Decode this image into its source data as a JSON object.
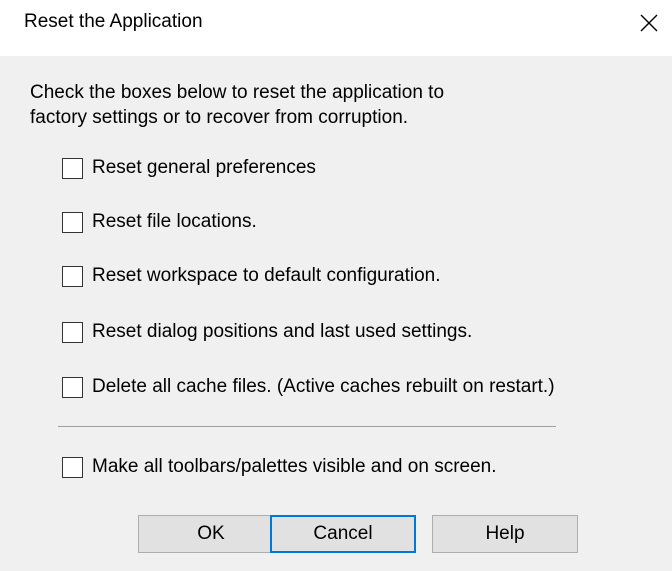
{
  "window": {
    "title": "Reset the Application"
  },
  "instruction": "Check the boxes below to reset the application to\nfactory settings or to recover from corruption.",
  "options": [
    {
      "label": "Reset general preferences",
      "checked": false
    },
    {
      "label": "Reset file locations.",
      "checked": false
    },
    {
      "label": "Reset workspace to default configuration.",
      "checked": false
    },
    {
      "label": "Reset dialog positions and last used settings.",
      "checked": false
    },
    {
      "label": "Delete all cache files.  (Active caches rebuilt on restart.)",
      "checked": false
    },
    {
      "label": "Make all toolbars/palettes visible and on screen.",
      "checked": false
    }
  ],
  "buttons": {
    "ok": "OK",
    "cancel": "Cancel",
    "help": "Help"
  },
  "colors": {
    "dialog_background": "#f0f0f0",
    "titlebar_background": "#ffffff",
    "default_button_border": "#0078d7"
  }
}
